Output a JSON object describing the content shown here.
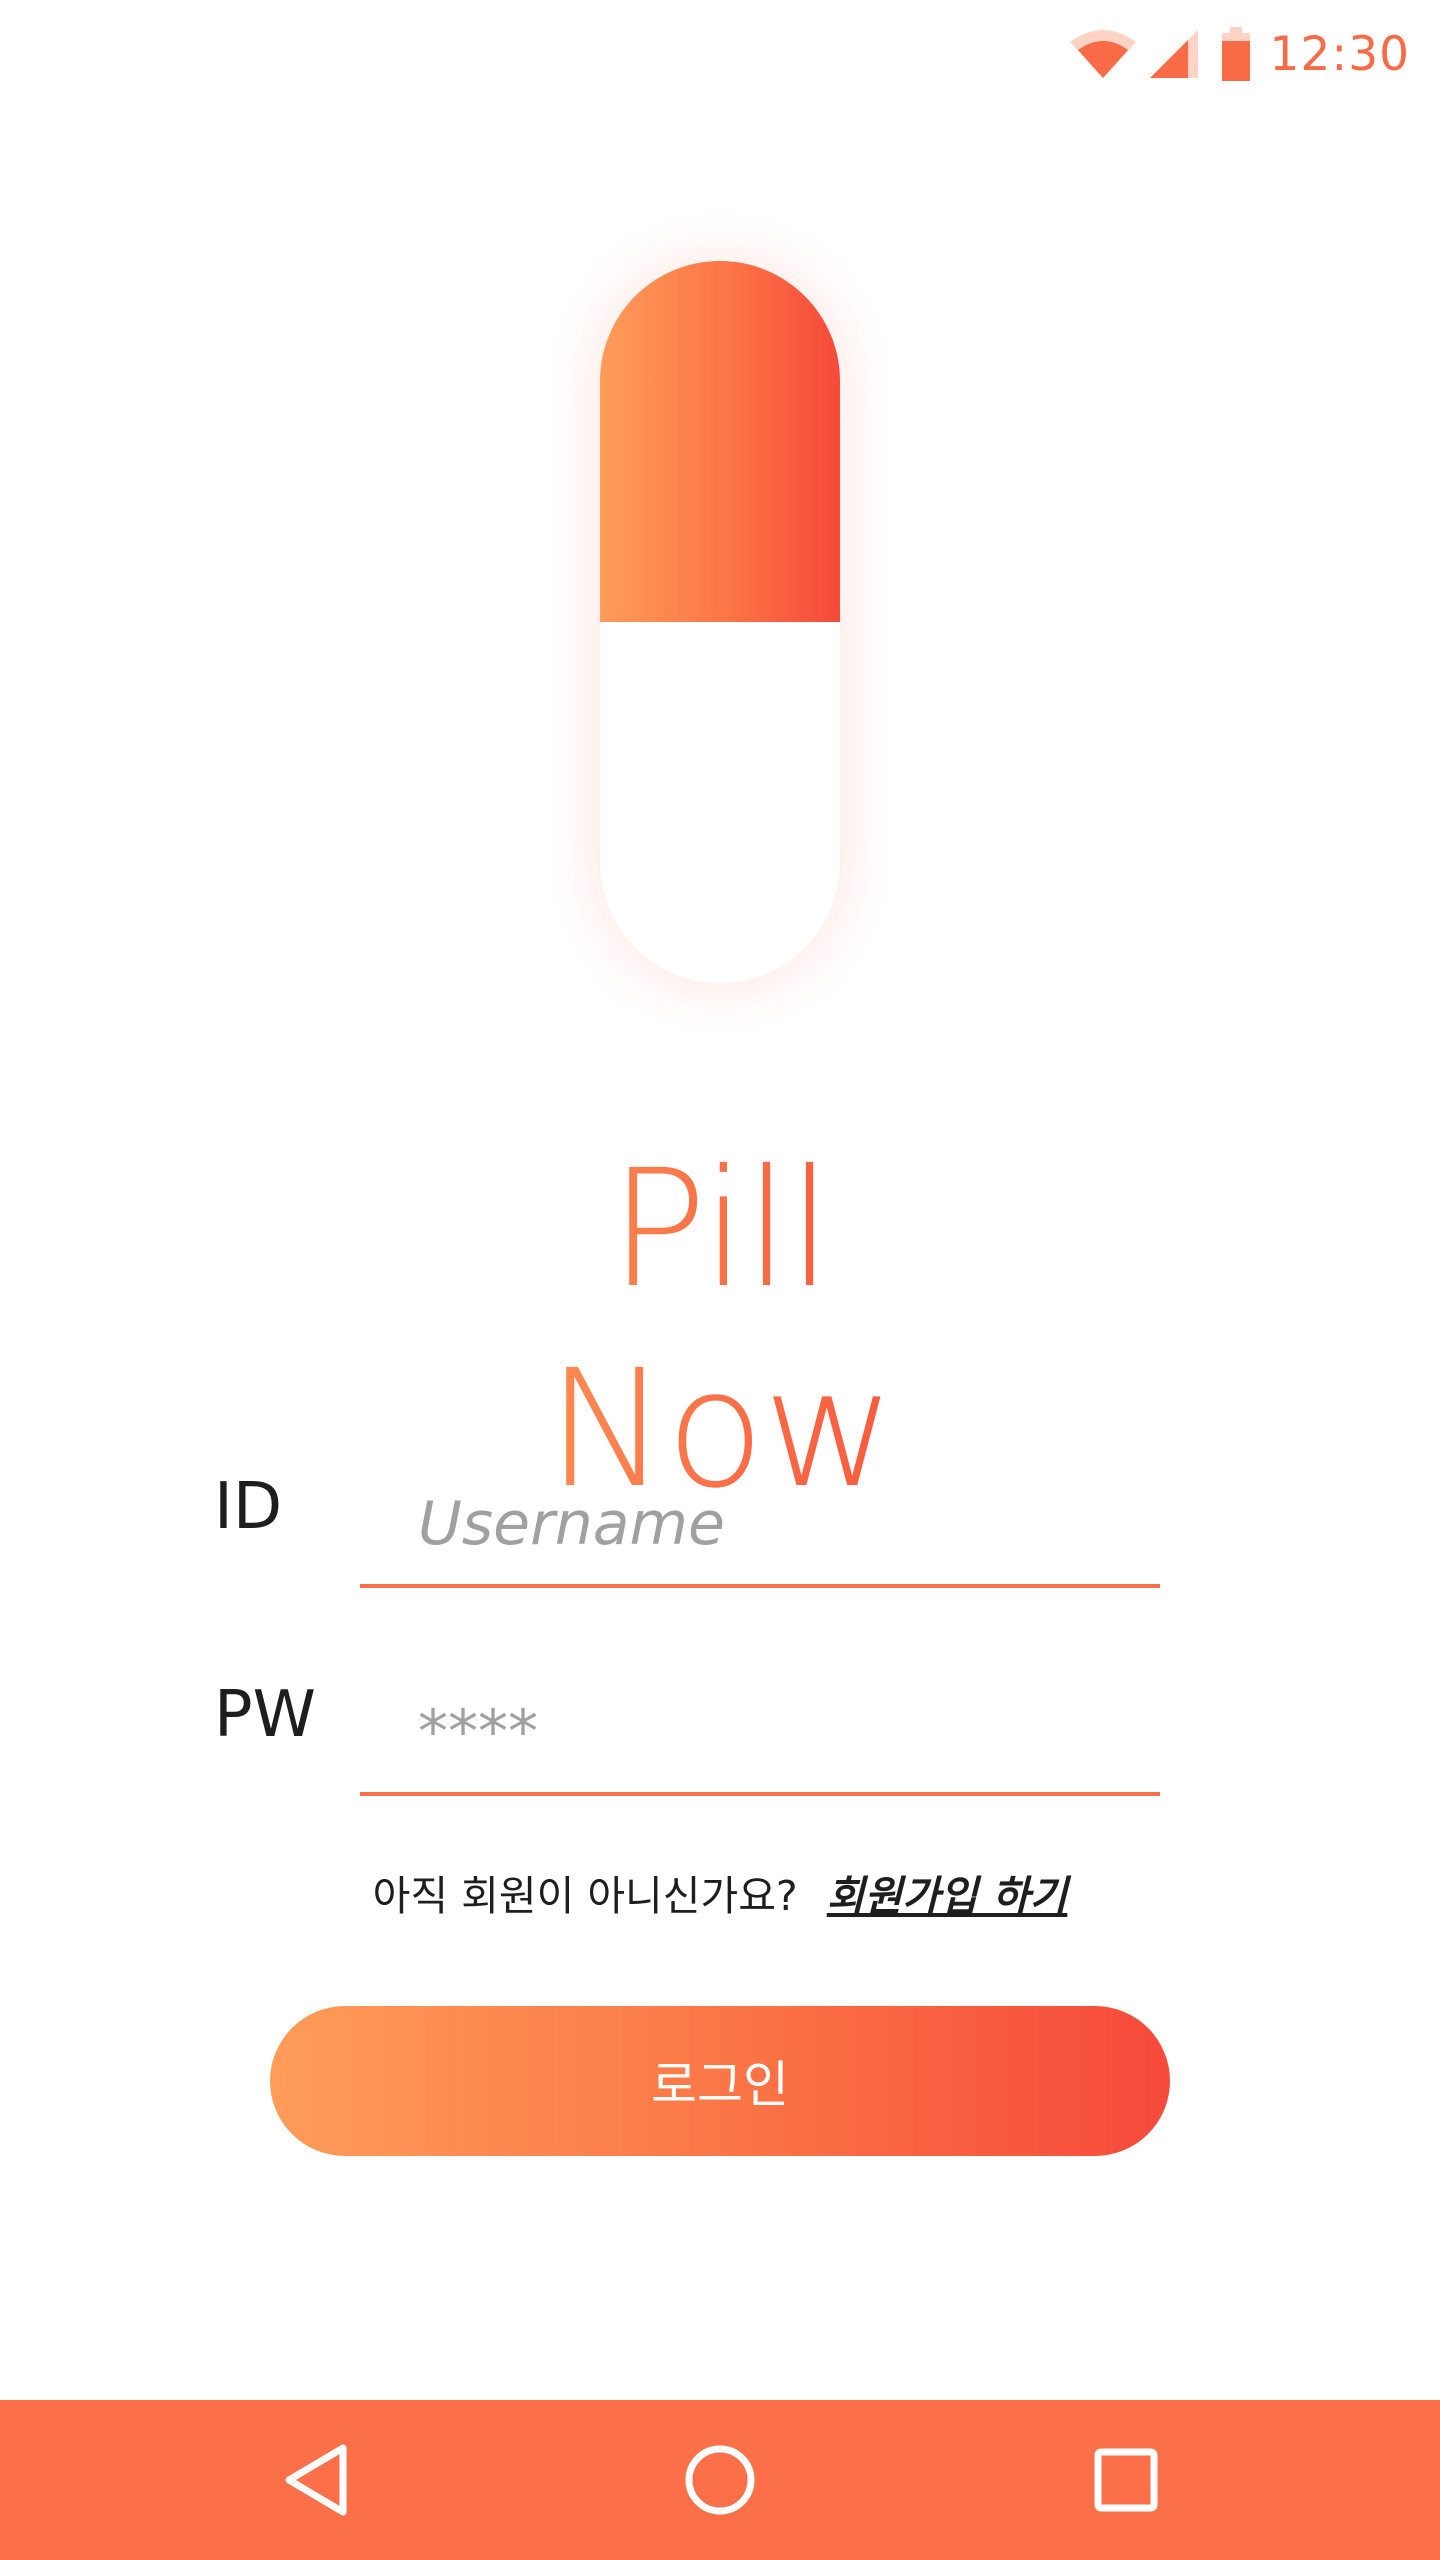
{
  "status_bar": {
    "time": "12:30",
    "icons": [
      "wifi-icon",
      "signal-icon",
      "battery-icon"
    ],
    "accent_color": "#f96a47"
  },
  "app": {
    "title": "Pill Now",
    "logo": "pill-icon",
    "gradient_start": "#fe9c58",
    "gradient_end": "#f6493a"
  },
  "form": {
    "id_label": "ID",
    "id_placeholder": "Username",
    "pw_label": "PW",
    "pw_placeholder": "****",
    "signup_prompt": "아직 회원이 아니신가요?",
    "signup_link": "회원가입 하기",
    "login_label": "로그인"
  },
  "nav_bar": {
    "color": "#fb6f49",
    "items": [
      "back-icon",
      "home-icon",
      "recent-apps-icon"
    ]
  }
}
